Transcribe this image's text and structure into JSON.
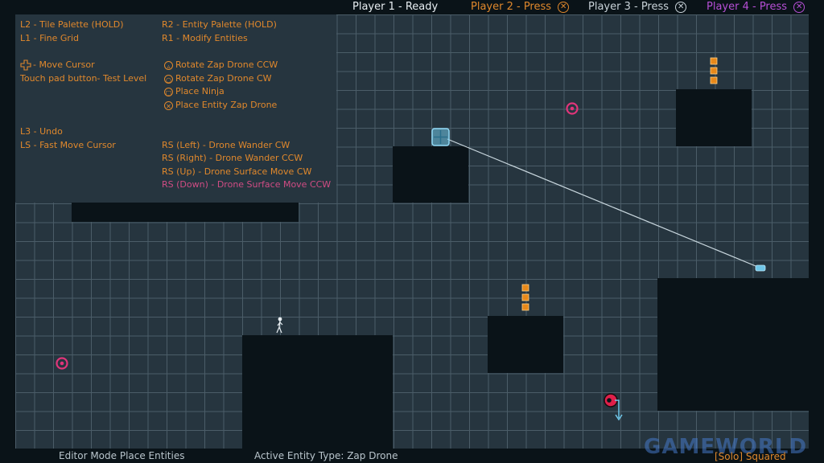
{
  "players": [
    {
      "label": "Player 1 - Ready",
      "color": "#e8eef2",
      "press": false
    },
    {
      "label": "Player 2 - Press",
      "color": "#e0882c",
      "press": true
    },
    {
      "label": "Player 3 - Press",
      "color": "#c9d3d9",
      "press": true
    },
    {
      "label": "Player 4 - Press",
      "color": "#b64fd6",
      "press": true
    }
  ],
  "help": {
    "l2": "L2 - Tile Palette (HOLD)",
    "l1": "L1 - Fine Grid",
    "move_cursor": "- Move Cursor",
    "touchpad": "Touch pad button- Test Level",
    "l3": "L3 - Undo",
    "ls": "LS - Fast Move Cursor",
    "r2": "R2 - Entity Palette (HOLD)",
    "r1": "R1 - Modify Entities",
    "triangle": "Rotate Zap Drone CCW",
    "circle": "Rotate Zap Drone CW",
    "square": "Place Ninja",
    "cross": "Place Entity Zap Drone",
    "rs_left": "RS (Left) - Drone Wander CW",
    "rs_right": "RS (Right) - Drone Wander CCW",
    "rs_up": "RS (Up) - Drone Surface Move CW",
    "rs_down": "RS (Down) - Drone Surface Move CCW"
  },
  "icons": {
    "dpad": "dpad-icon",
    "triangle": "triangle-button-icon",
    "circle": "circle-button-icon",
    "square": "square-button-icon",
    "cross": "cross-button-icon"
  },
  "status": {
    "mode": "Editor Mode Place Entities",
    "active_entity": "Active Entity Type: Zap Drone",
    "solo": "[Solo] Squared"
  },
  "watermark": "GAMEWORLD",
  "colors": {
    "orange": "#e0882c",
    "pink": "#d04c84",
    "cyan": "#6fc6e8",
    "grid_bg": "#26353f",
    "wall": "#0a1318"
  }
}
